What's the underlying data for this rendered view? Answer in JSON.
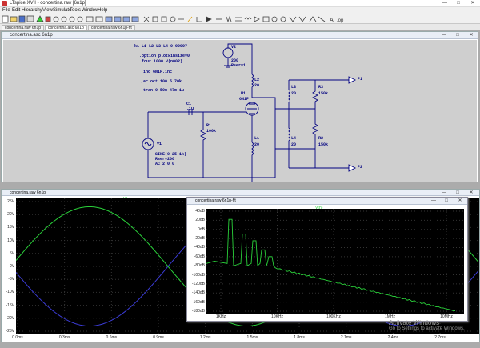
{
  "app": {
    "title": "LTspice XVII - concertina.raw [6n1p]"
  },
  "menubar": [
    "File",
    "Edit",
    "Hierarchy",
    "View",
    "Simulate",
    "Tools",
    "Window",
    "Help"
  ],
  "tabs": [
    "concertina.raw  6n1p",
    "concertina.asc  6n1p",
    "concertina.raw  6n1p-fft"
  ],
  "schematic": {
    "window_title": "concertina.asc  6n1p",
    "directives": [
      "k1 L1 L2 L3 L4 0.99997",
      ".option plotwinsize=0",
      ".four 1000 V(n002)",
      ".inc 6N1P.inc",
      ";ac oct 100 5 70k",
      ".tran 0 50m 47m 1u"
    ],
    "v2": {
      "name": "V2",
      "value": "200",
      "rser": "Rser=1"
    },
    "c1": {
      "name": "C1",
      "value": ".1µ"
    },
    "r1": {
      "name": "R1",
      "value": "100k"
    },
    "v1": {
      "name": "V1",
      "value": "SINE(0 25 1k)",
      "rser": "Rser=200",
      "ac": "AC 2 0 0"
    },
    "u1": {
      "name": "U1",
      "value": "6N1P"
    },
    "l1": {
      "name": "L1",
      "value": "20"
    },
    "l2": {
      "name": "L2",
      "value": "20"
    },
    "l3": {
      "name": "L3",
      "value": "20"
    },
    "l4": {
      "name": "L4",
      "value": "20"
    },
    "r3": {
      "name": "R3",
      "value": "150k"
    },
    "r2": {
      "name": "R2",
      "value": "150k"
    },
    "p1": "P1",
    "p2": "P2"
  },
  "waveA": {
    "window_title": "concertina.raw  6n1p",
    "trace_label": "V(n)",
    "yticks": [
      "25V",
      "20V",
      "15V",
      "10V",
      "5V",
      "0V",
      "-5V",
      "-10V",
      "-15V",
      "-20V",
      "-25V"
    ],
    "xticks": [
      "0.0ms",
      "0.3ms",
      "0.6ms",
      "0.9ms",
      "1.2ms",
      "1.5ms",
      "1.8ms",
      "2.1ms",
      "2.4ms",
      "2.7ms"
    ]
  },
  "waveB": {
    "window_title": "concertina.raw  6n1p-fft",
    "trace_label": "V(n)",
    "yticks": [
      "40dB",
      "20dB",
      "0dB",
      "-20dB",
      "-40dB",
      "-60dB",
      "-80dB",
      "-100dB",
      "-120dB",
      "-140dB",
      "-160dB",
      "-180dB"
    ],
    "xticks": [
      "1KHz",
      "10KHz",
      "100KHz",
      "1MHz",
      "10MHz"
    ]
  },
  "watermark": {
    "line1": "Activate Windows",
    "line2": "Go to Settings to activate Windows."
  },
  "colors": {
    "trace1": "#2ad13a",
    "trace2": "#3b3bd6",
    "wire": "#000080",
    "schbg": "#cfcfcf"
  }
}
